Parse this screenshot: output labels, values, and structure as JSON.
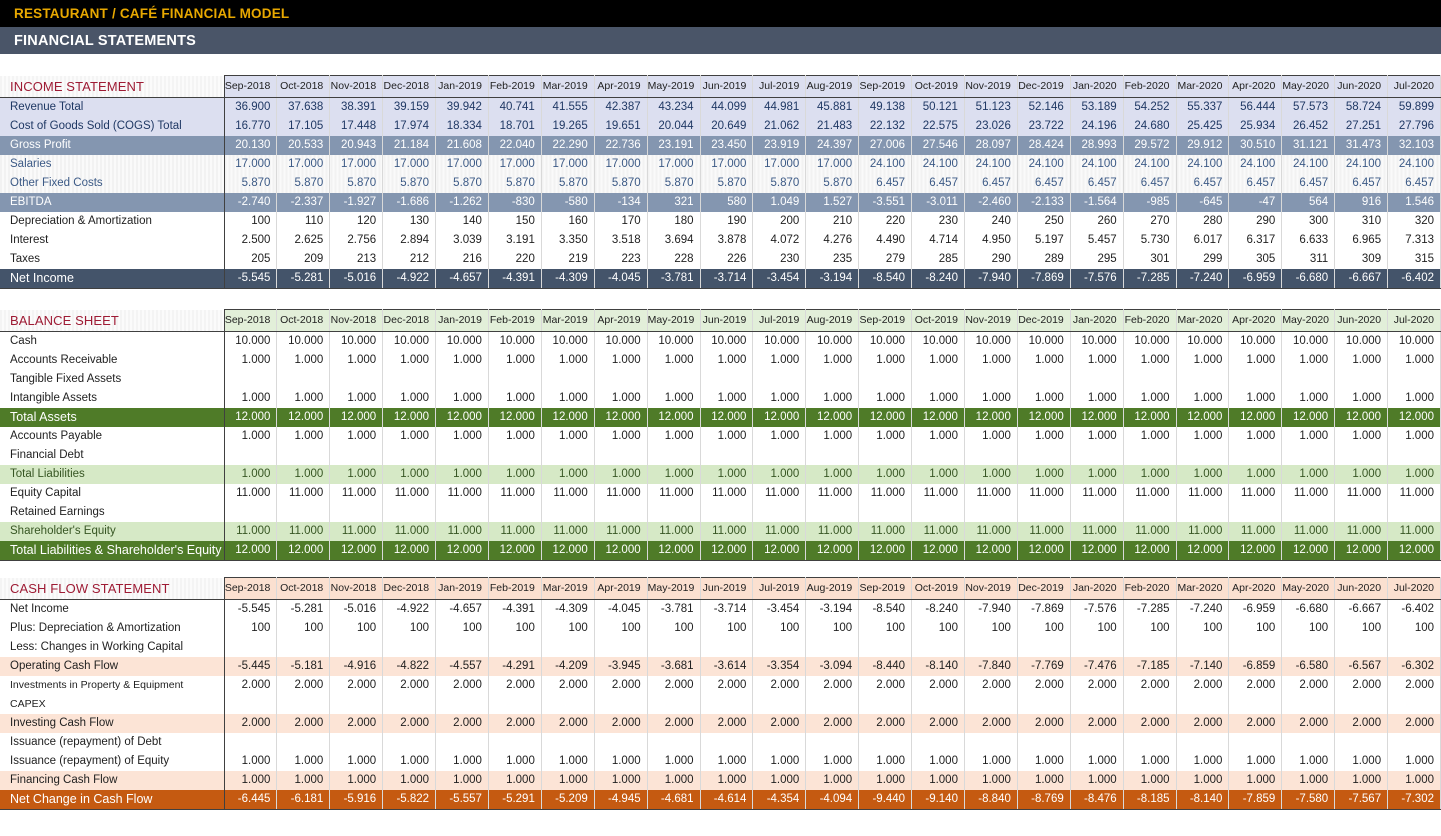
{
  "header": {
    "brand_title": "RESTAURANT / CAFÉ FINANCIAL MODEL",
    "section_title": "FINANCIAL STATEMENTS"
  },
  "colors": {
    "brand_bar": "#000000",
    "brand_text": "#e8a800",
    "section_bar": "#4a5568",
    "section_title_text": "#9e1b34",
    "income_total": "#44546a",
    "income_sub": "#8496b0",
    "balance_total": "#4f7b28",
    "balance_subtotal": "#d6e9c6",
    "cashflow_total": "#c55a11",
    "cashflow_subtotal": "#fce4d6"
  },
  "periods": [
    "Sep-2018",
    "Oct-2018",
    "Nov-2018",
    "Dec-2018",
    "Jan-2019",
    "Feb-2019",
    "Mar-2019",
    "Apr-2019",
    "May-2019",
    "Jun-2019",
    "Jul-2019",
    "Aug-2019",
    "Sep-2019",
    "Oct-2019",
    "Nov-2019",
    "Dec-2019",
    "Jan-2020",
    "Feb-2020",
    "Mar-2020",
    "Apr-2020",
    "May-2020",
    "Jun-2020",
    "Jul-2020"
  ],
  "income_statement": {
    "title": "INCOME STATEMENT",
    "rows": [
      {
        "label": "Revenue Total",
        "style": "is-main",
        "values": [
          "36.900",
          "37.638",
          "38.391",
          "39.159",
          "39.942",
          "40.741",
          "41.555",
          "42.387",
          "43.234",
          "44.099",
          "44.981",
          "45.881",
          "49.138",
          "50.121",
          "51.123",
          "52.146",
          "53.189",
          "54.252",
          "55.337",
          "56.444",
          "57.573",
          "58.724",
          "59.899"
        ]
      },
      {
        "label": "Cost of Goods Sold (COGS) Total",
        "style": "is-main",
        "values": [
          "16.770",
          "17.105",
          "17.448",
          "17.974",
          "18.334",
          "18.701",
          "19.265",
          "19.651",
          "20.044",
          "20.649",
          "21.062",
          "21.483",
          "22.132",
          "22.575",
          "23.026",
          "23.722",
          "24.196",
          "24.680",
          "25.425",
          "25.934",
          "26.452",
          "27.251",
          "27.796"
        ]
      },
      {
        "label": "Gross Profit",
        "style": "is-sub",
        "values": [
          "20.130",
          "20.533",
          "20.943",
          "21.184",
          "21.608",
          "22.040",
          "22.290",
          "22.736",
          "23.191",
          "23.450",
          "23.919",
          "24.397",
          "27.006",
          "27.546",
          "28.097",
          "28.424",
          "28.993",
          "29.572",
          "29.912",
          "30.510",
          "31.121",
          "31.473",
          "32.103"
        ]
      },
      {
        "label": "Salaries",
        "style": "is-detail",
        "values": [
          "17.000",
          "17.000",
          "17.000",
          "17.000",
          "17.000",
          "17.000",
          "17.000",
          "17.000",
          "17.000",
          "17.000",
          "17.000",
          "17.000",
          "24.100",
          "24.100",
          "24.100",
          "24.100",
          "24.100",
          "24.100",
          "24.100",
          "24.100",
          "24.100",
          "24.100",
          "24.100"
        ]
      },
      {
        "label": "Other Fixed Costs",
        "style": "is-detail",
        "values": [
          "5.870",
          "5.870",
          "5.870",
          "5.870",
          "5.870",
          "5.870",
          "5.870",
          "5.870",
          "5.870",
          "5.870",
          "5.870",
          "5.870",
          "6.457",
          "6.457",
          "6.457",
          "6.457",
          "6.457",
          "6.457",
          "6.457",
          "6.457",
          "6.457",
          "6.457",
          "6.457"
        ]
      },
      {
        "label": "EBITDA",
        "style": "is-sub",
        "values": [
          "-2.740",
          "-2.337",
          "-1.927",
          "-1.686",
          "-1.262",
          "-830",
          "-580",
          "-134",
          "321",
          "580",
          "1.049",
          "1.527",
          "-3.551",
          "-3.011",
          "-2.460",
          "-2.133",
          "-1.564",
          "-985",
          "-645",
          "-47",
          "564",
          "916",
          "1.546"
        ]
      },
      {
        "label": "Depreciation & Amortization",
        "style": "is-plain",
        "values": [
          "100",
          "110",
          "120",
          "130",
          "140",
          "150",
          "160",
          "170",
          "180",
          "190",
          "200",
          "210",
          "220",
          "230",
          "240",
          "250",
          "260",
          "270",
          "280",
          "290",
          "300",
          "310",
          "320"
        ]
      },
      {
        "label": "Interest",
        "style": "is-plain",
        "values": [
          "2.500",
          "2.625",
          "2.756",
          "2.894",
          "3.039",
          "3.191",
          "3.350",
          "3.518",
          "3.694",
          "3.878",
          "4.072",
          "4.276",
          "4.490",
          "4.714",
          "4.950",
          "5.197",
          "5.457",
          "5.730",
          "6.017",
          "6.317",
          "6.633",
          "6.965",
          "7.313"
        ]
      },
      {
        "label": "Taxes",
        "style": "is-plain",
        "values": [
          "205",
          "209",
          "213",
          "212",
          "216",
          "220",
          "219",
          "223",
          "228",
          "226",
          "230",
          "235",
          "279",
          "285",
          "290",
          "289",
          "295",
          "301",
          "299",
          "305",
          "311",
          "309",
          "315"
        ]
      },
      {
        "label": "Net Income",
        "style": "is-total",
        "values": [
          "-5.545",
          "-5.281",
          "-5.016",
          "-4.922",
          "-4.657",
          "-4.391",
          "-4.309",
          "-4.045",
          "-3.781",
          "-3.714",
          "-3.454",
          "-3.194",
          "-8.540",
          "-8.240",
          "-7.940",
          "-7.869",
          "-7.576",
          "-7.285",
          "-7.240",
          "-6.959",
          "-6.680",
          "-6.667",
          "-6.402"
        ]
      }
    ]
  },
  "balance_sheet": {
    "title": "BALANCE SHEET",
    "rows": [
      {
        "label": "Cash",
        "style": "bs-plain",
        "values": [
          "10.000",
          "10.000",
          "10.000",
          "10.000",
          "10.000",
          "10.000",
          "10.000",
          "10.000",
          "10.000",
          "10.000",
          "10.000",
          "10.000",
          "10.000",
          "10.000",
          "10.000",
          "10.000",
          "10.000",
          "10.000",
          "10.000",
          "10.000",
          "10.000",
          "10.000",
          "10.000"
        ]
      },
      {
        "label": "Accounts Receivable",
        "style": "bs-plain",
        "values": [
          "1.000",
          "1.000",
          "1.000",
          "1.000",
          "1.000",
          "1.000",
          "1.000",
          "1.000",
          "1.000",
          "1.000",
          "1.000",
          "1.000",
          "1.000",
          "1.000",
          "1.000",
          "1.000",
          "1.000",
          "1.000",
          "1.000",
          "1.000",
          "1.000",
          "1.000",
          "1.000"
        ]
      },
      {
        "label": "Tangible Fixed Assets",
        "style": "bs-plain",
        "values": [
          "",
          "",
          "",
          "",
          "",
          "",
          "",
          "",
          "",
          "",
          "",
          "",
          "",
          "",
          "",
          "",
          "",
          "",
          "",
          "",
          "",
          "",
          ""
        ]
      },
      {
        "label": "Intangible Assets",
        "style": "bs-plain",
        "values": [
          "1.000",
          "1.000",
          "1.000",
          "1.000",
          "1.000",
          "1.000",
          "1.000",
          "1.000",
          "1.000",
          "1.000",
          "1.000",
          "1.000",
          "1.000",
          "1.000",
          "1.000",
          "1.000",
          "1.000",
          "1.000",
          "1.000",
          "1.000",
          "1.000",
          "1.000",
          "1.000"
        ]
      },
      {
        "label": "Total Assets",
        "style": "bs-total-dark",
        "values": [
          "12.000",
          "12.000",
          "12.000",
          "12.000",
          "12.000",
          "12.000",
          "12.000",
          "12.000",
          "12.000",
          "12.000",
          "12.000",
          "12.000",
          "12.000",
          "12.000",
          "12.000",
          "12.000",
          "12.000",
          "12.000",
          "12.000",
          "12.000",
          "12.000",
          "12.000",
          "12.000"
        ]
      },
      {
        "label": "Accounts Payable",
        "style": "bs-plain",
        "values": [
          "1.000",
          "1.000",
          "1.000",
          "1.000",
          "1.000",
          "1.000",
          "1.000",
          "1.000",
          "1.000",
          "1.000",
          "1.000",
          "1.000",
          "1.000",
          "1.000",
          "1.000",
          "1.000",
          "1.000",
          "1.000",
          "1.000",
          "1.000",
          "1.000",
          "1.000",
          "1.000"
        ]
      },
      {
        "label": "Financial Debt",
        "style": "bs-plain",
        "values": [
          "",
          "",
          "",
          "",
          "",
          "",
          "",
          "",
          "",
          "",
          "",
          "",
          "",
          "",
          "",
          "",
          "",
          "",
          "",
          "",
          "",
          "",
          ""
        ]
      },
      {
        "label": "Total Liabilities",
        "style": "bs-total-light",
        "values": [
          "1.000",
          "1.000",
          "1.000",
          "1.000",
          "1.000",
          "1.000",
          "1.000",
          "1.000",
          "1.000",
          "1.000",
          "1.000",
          "1.000",
          "1.000",
          "1.000",
          "1.000",
          "1.000",
          "1.000",
          "1.000",
          "1.000",
          "1.000",
          "1.000",
          "1.000",
          "1.000"
        ]
      },
      {
        "label": "Equity Capital",
        "style": "bs-plain",
        "values": [
          "11.000",
          "11.000",
          "11.000",
          "11.000",
          "11.000",
          "11.000",
          "11.000",
          "11.000",
          "11.000",
          "11.000",
          "11.000",
          "11.000",
          "11.000",
          "11.000",
          "11.000",
          "11.000",
          "11.000",
          "11.000",
          "11.000",
          "11.000",
          "11.000",
          "11.000",
          "11.000"
        ]
      },
      {
        "label": "Retained Earnings",
        "style": "bs-plain",
        "values": [
          "",
          "",
          "",
          "",
          "",
          "",
          "",
          "",
          "",
          "",
          "",
          "",
          "",
          "",
          "",
          "",
          "",
          "",
          "",
          "",
          "",
          "",
          ""
        ]
      },
      {
        "label": "Shareholder's Equity",
        "style": "bs-total-light",
        "values": [
          "11.000",
          "11.000",
          "11.000",
          "11.000",
          "11.000",
          "11.000",
          "11.000",
          "11.000",
          "11.000",
          "11.000",
          "11.000",
          "11.000",
          "11.000",
          "11.000",
          "11.000",
          "11.000",
          "11.000",
          "11.000",
          "11.000",
          "11.000",
          "11.000",
          "11.000",
          "11.000"
        ]
      },
      {
        "label": "Total Liabilities & Shareholder's Equity",
        "style": "bs-total-dark",
        "values": [
          "12.000",
          "12.000",
          "12.000",
          "12.000",
          "12.000",
          "12.000",
          "12.000",
          "12.000",
          "12.000",
          "12.000",
          "12.000",
          "12.000",
          "12.000",
          "12.000",
          "12.000",
          "12.000",
          "12.000",
          "12.000",
          "12.000",
          "12.000",
          "12.000",
          "12.000",
          "12.000"
        ]
      }
    ]
  },
  "cash_flow_statement": {
    "title": "CASH FLOW STATEMENT",
    "rows": [
      {
        "label": "Net Income",
        "style": "cf-plain",
        "values": [
          "-5.545",
          "-5.281",
          "-5.016",
          "-4.922",
          "-4.657",
          "-4.391",
          "-4.309",
          "-4.045",
          "-3.781",
          "-3.714",
          "-3.454",
          "-3.194",
          "-8.540",
          "-8.240",
          "-7.940",
          "-7.869",
          "-7.576",
          "-7.285",
          "-7.240",
          "-6.959",
          "-6.680",
          "-6.667",
          "-6.402"
        ]
      },
      {
        "label": "Plus: Depreciation & Amortization",
        "style": "cf-plain",
        "values": [
          "100",
          "100",
          "100",
          "100",
          "100",
          "100",
          "100",
          "100",
          "100",
          "100",
          "100",
          "100",
          "100",
          "100",
          "100",
          "100",
          "100",
          "100",
          "100",
          "100",
          "100",
          "100",
          "100"
        ]
      },
      {
        "label": "Less: Changes in Working Capital",
        "style": "cf-plain",
        "values": [
          "",
          "",
          "",
          "",
          "",
          "",
          "",
          "",
          "",
          "",
          "",
          "",
          "",
          "",
          "",
          "",
          "",
          "",
          "",
          "",
          "",
          "",
          ""
        ]
      },
      {
        "label": "Operating Cash Flow",
        "style": "cf-sub",
        "values": [
          "-5.445",
          "-5.181",
          "-4.916",
          "-4.822",
          "-4.557",
          "-4.291",
          "-4.209",
          "-3.945",
          "-3.681",
          "-3.614",
          "-3.354",
          "-3.094",
          "-8.440",
          "-8.140",
          "-7.840",
          "-7.769",
          "-7.476",
          "-7.185",
          "-7.140",
          "-6.859",
          "-6.580",
          "-6.567",
          "-6.302"
        ]
      },
      {
        "label": "Investments in Property & Equipment",
        "style": "cf-plain small",
        "values": [
          "2.000",
          "2.000",
          "2.000",
          "2.000",
          "2.000",
          "2.000",
          "2.000",
          "2.000",
          "2.000",
          "2.000",
          "2.000",
          "2.000",
          "2.000",
          "2.000",
          "2.000",
          "2.000",
          "2.000",
          "2.000",
          "2.000",
          "2.000",
          "2.000",
          "2.000",
          "2.000"
        ]
      },
      {
        "label": "CAPEX",
        "style": "cf-plain small",
        "values": [
          "",
          "",
          "",
          "",
          "",
          "",
          "",
          "",
          "",
          "",
          "",
          "",
          "",
          "",
          "",
          "",
          "",
          "",
          "",
          "",
          "",
          "",
          ""
        ]
      },
      {
        "label": "Investing Cash Flow",
        "style": "cf-sub",
        "values": [
          "2.000",
          "2.000",
          "2.000",
          "2.000",
          "2.000",
          "2.000",
          "2.000",
          "2.000",
          "2.000",
          "2.000",
          "2.000",
          "2.000",
          "2.000",
          "2.000",
          "2.000",
          "2.000",
          "2.000",
          "2.000",
          "2.000",
          "2.000",
          "2.000",
          "2.000",
          "2.000"
        ]
      },
      {
        "label": "Issuance (repayment) of Debt",
        "style": "cf-plain",
        "values": [
          "",
          "",
          "",
          "",
          "",
          "",
          "",
          "",
          "",
          "",
          "",
          "",
          "",
          "",
          "",
          "",
          "",
          "",
          "",
          "",
          "",
          "",
          ""
        ]
      },
      {
        "label": "Issuance (repayment) of Equity",
        "style": "cf-plain",
        "values": [
          "1.000",
          "1.000",
          "1.000",
          "1.000",
          "1.000",
          "1.000",
          "1.000",
          "1.000",
          "1.000",
          "1.000",
          "1.000",
          "1.000",
          "1.000",
          "1.000",
          "1.000",
          "1.000",
          "1.000",
          "1.000",
          "1.000",
          "1.000",
          "1.000",
          "1.000",
          "1.000"
        ]
      },
      {
        "label": "Financing Cash Flow",
        "style": "cf-sub",
        "values": [
          "1.000",
          "1.000",
          "1.000",
          "1.000",
          "1.000",
          "1.000",
          "1.000",
          "1.000",
          "1.000",
          "1.000",
          "1.000",
          "1.000",
          "1.000",
          "1.000",
          "1.000",
          "1.000",
          "1.000",
          "1.000",
          "1.000",
          "1.000",
          "1.000",
          "1.000",
          "1.000"
        ]
      },
      {
        "label": "Net Change in Cash Flow",
        "style": "cf-total",
        "values": [
          "-6.445",
          "-6.181",
          "-5.916",
          "-5.822",
          "-5.557",
          "-5.291",
          "-5.209",
          "-4.945",
          "-4.681",
          "-4.614",
          "-4.354",
          "-4.094",
          "-9.440",
          "-9.140",
          "-8.840",
          "-8.769",
          "-8.476",
          "-8.185",
          "-8.140",
          "-7.859",
          "-7.580",
          "-7.567",
          "-7.302"
        ]
      }
    ]
  }
}
